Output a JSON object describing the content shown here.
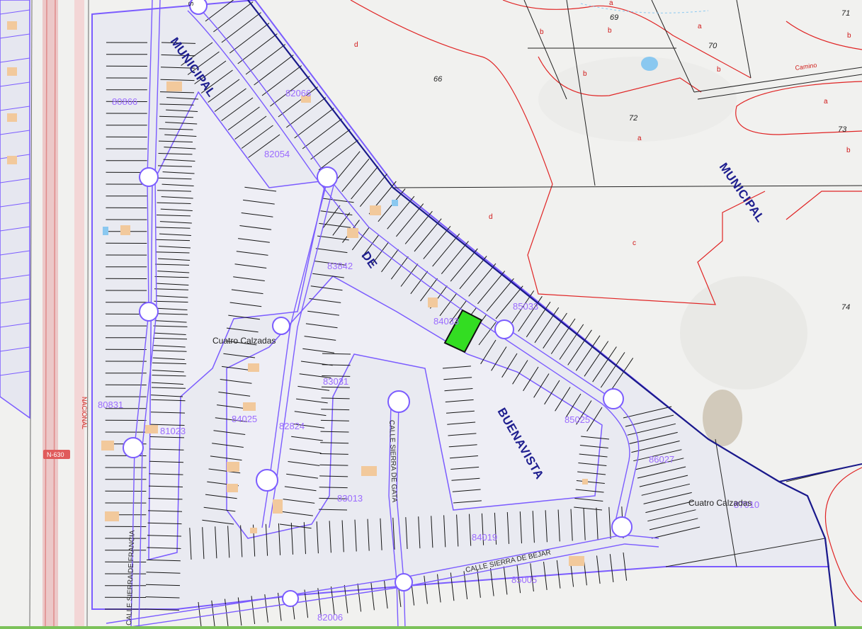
{
  "colors": {
    "background": "#f1f1ef",
    "block_fill": "#e9eaf1",
    "parcel_line": "#7b5cff",
    "lot_line": "#111111",
    "municipal_border": "#1a1a8a",
    "rustic_line": "#e02424",
    "highway": "#e8a8a8",
    "highlight": "#33dd22",
    "house": "#f2c99c",
    "pool": "#8ac8f0"
  },
  "parcel_labels": [
    {
      "id": "p82066",
      "text": "82066"
    },
    {
      "id": "p80866",
      "text": "80866"
    },
    {
      "id": "p82054",
      "text": "82054"
    },
    {
      "id": "p83842",
      "text": "83842"
    },
    {
      "id": "p84033",
      "text": "84033"
    },
    {
      "id": "p85033",
      "text": "85033"
    },
    {
      "id": "p83031",
      "text": "83031"
    },
    {
      "id": "p80831",
      "text": "80831"
    },
    {
      "id": "p81023",
      "text": "81023"
    },
    {
      "id": "p84025",
      "text": "84025"
    },
    {
      "id": "p82824",
      "text": "82824"
    },
    {
      "id": "p85025",
      "text": "85025"
    },
    {
      "id": "p86027",
      "text": "86027"
    },
    {
      "id": "p83013",
      "text": "83013"
    },
    {
      "id": "p84019",
      "text": "84019"
    },
    {
      "id": "p85005",
      "text": "85005"
    },
    {
      "id": "p82006",
      "text": "82006"
    },
    {
      "id": "p87010",
      "text": "87010"
    }
  ],
  "street_labels": {
    "municipal_1": "MUNICIPAL",
    "municipal_2": "MUNICIPAL",
    "de": "DE",
    "buenavista": "BUENAVISTA",
    "calle_sierra_de_gata": "CALLE SIERRA DE GATA",
    "calle_sierra_de_bejar": "CALLE SIERRA DE BEJAR",
    "calle_sierra_de_francia": "CALLE SIERRA DE FRANCIA",
    "nacional": "NACIONAL",
    "top_fragment": "S"
  },
  "place_labels": {
    "cuatro_calzadas_1": "Cuatro Calzadas",
    "cuatro_calzadas_2": "Cuatro Calzadas"
  },
  "road_badge": "N-630",
  "camino": "Camino",
  "land_numbers": [
    {
      "id": "n66",
      "text": "66"
    },
    {
      "id": "n69",
      "text": "69"
    },
    {
      "id": "n70",
      "text": "70"
    },
    {
      "id": "n71",
      "text": "71"
    },
    {
      "id": "n72",
      "text": "72"
    },
    {
      "id": "n73",
      "text": "73"
    },
    {
      "id": "n74",
      "text": "74"
    }
  ],
  "land_letters": [
    {
      "id": "l1",
      "text": "d"
    },
    {
      "id": "l2",
      "text": "b"
    },
    {
      "id": "l3",
      "text": "b"
    },
    {
      "id": "l4",
      "text": "a"
    },
    {
      "id": "l5",
      "text": "b"
    },
    {
      "id": "l6",
      "text": "b"
    },
    {
      "id": "l7",
      "text": "a"
    },
    {
      "id": "l8",
      "text": "a"
    },
    {
      "id": "l9",
      "text": "b"
    },
    {
      "id": "l10",
      "text": "a"
    },
    {
      "id": "l11",
      "text": "b"
    },
    {
      "id": "l12",
      "text": "d"
    },
    {
      "id": "l13",
      "text": "c"
    }
  ]
}
